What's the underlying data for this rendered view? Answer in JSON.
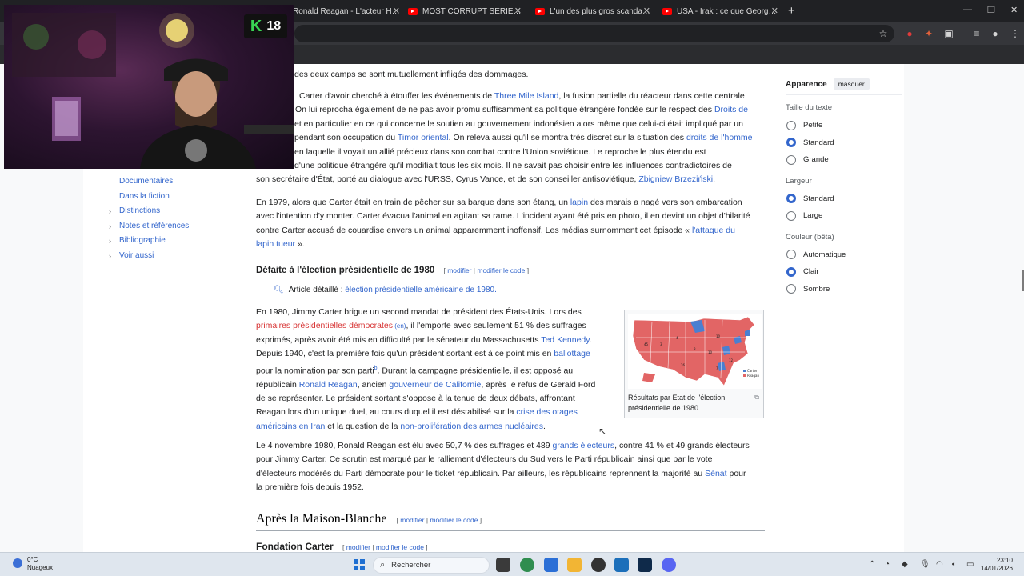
{
  "browser": {
    "tabs": [
      {
        "label": "Ronald Reagan - L'acteur Holly…"
      },
      {
        "label": "MOST CORRUPT SERIES: Presid…"
      },
      {
        "label": "L'un des plus gros scandale de…"
      },
      {
        "label": "USA - Irak : ce que George W B…"
      }
    ]
  },
  "webcam": {
    "badge_letter": "K",
    "badge_number": "18"
  },
  "toc": {
    "items": [
      {
        "label": "Documentaires",
        "expandable": false
      },
      {
        "label": "Dans la fiction",
        "expandable": false
      },
      {
        "label": "Distinctions",
        "expandable": true
      },
      {
        "label": "Notes et références",
        "expandable": true
      },
      {
        "label": "Bibliographie",
        "expandable": true
      },
      {
        "label": "Voir aussi",
        "expandable": true
      }
    ]
  },
  "article": {
    "p0": {
      "l1": "des deux camps se sont mutuellement infligés des dommages."
    },
    "p1": {
      "l1a": "Carter d'avoir cherché à étouffer les événements de ",
      "l1_link": "Three Mile Island",
      "l1b": ", la fusion partielle du réacteur dans cette centrale",
      "l2a": "On lui reprocha également de ne pas avoir promu suffisamment sa politique étrangère fondée sur le respect des ",
      "l2_link": "Droits de",
      "l3": "et en particulier en ce qui concerne le soutien au gouvernement indonésien alors même que celui-ci était impliqué par un",
      "l4a": "pendant son occupation du ",
      "l4_link": "Timor oriental",
      "l4b": ". On releva aussi qu'il se montra très discret sur la situation des ",
      "l4_link2": "droits de l'homme",
      "l5": "en laquelle il voyait un allié précieux dans son combat contre l'Union soviétique. Le reproche le plus étendu est",
      "l6": "d'une politique étrangère qu'il modifiait tous les six mois. Il ne savait pas choisir entre les influences contradictoires de",
      "l7a": "son secrétaire d'État, porté au dialogue avec l'URSS, Cyrus Vance, et de son conseiller antisoviétique, ",
      "l7_link": "Zbigniew Brzeziński",
      "l7b": "."
    },
    "p2": {
      "l1a": "En 1979, alors que Carter était en train de pêcher sur sa barque dans son étang, un ",
      "l1_link": "lapin",
      "l1b": " des marais a nagé vers son embarcation",
      "l2": "avec l'intention d'y monter. Carter évacua l'animal en agitant sa rame. L'incident ayant été pris en photo, il en devint un objet d'hilarité",
      "l3a": "contre Carter accusé de couardise envers un animal apparemment inoffensif. Les médias surnomment cet épisode « ",
      "l3_link": "l'attaque du",
      "l4_link": "lapin tueur",
      "l4b": " »."
    },
    "section_1980": {
      "title": "Défaite à l'élection présidentielle de 1980",
      "edit_open": "[ ",
      "edit": "modifier",
      "sep": " | ",
      "edit_code": "modifier le code",
      "edit_close": " ]",
      "hatnote_label": "Article détaillé : ",
      "hatnote_link": "élection présidentielle américaine de 1980."
    },
    "p3": {
      "l1": "En 1980, Jimmy Carter brigue un second mandat de président des États-Unis. Lors des",
      "l2_link": "primaires présidentielles démocrates",
      "l2_en": " (en)",
      "l2b": ", il l'emporte avec seulement 51 % des suffrages",
      "l3a": "exprimés, après avoir été mis en difficulté par le sénateur du Massachusetts ",
      "l3_link": "Ted Kennedy",
      "l3b": ".",
      "l4a": "Depuis 1940, c'est la première fois qu'un président sortant est à ce point mis en ",
      "l4_link": "ballottage",
      "l5a": "pour la nomination par son parti",
      "l5_sup": "b",
      "l5b": ". Durant la campagne présidentielle, il est opposé au",
      "l6a": "républicain ",
      "l6_link": "Ronald Reagan",
      "l6b": ", ancien ",
      "l6_link2": "gouverneur de Californie",
      "l6c": ", après le refus de Gerald Ford",
      "l7": "de se représenter. Le président sortant s'oppose à la tenue de deux débats, affrontant",
      "l8a": "Reagan lors d'un unique duel, au cours duquel il est déstabilisé sur la ",
      "l8_link": "crise des otages",
      "l9_link": "américains en Iran",
      "l9b": " et la question de la ",
      "l9_link2": "non-prolifération des armes nucléaires",
      "l9c": "."
    },
    "p4": {
      "l1a": "Le 4 novembre 1980, Ronald Reagan est élu avec 50,7 % des suffrages et 489 ",
      "l1_link": "grands électeurs",
      "l1b": ", contre 41 % et 49 grands électeurs",
      "l2": "pour Jimmy Carter. Ce scrutin est marqué par le ralliement d'électeurs du Sud vers le Parti républicain ainsi que par le vote",
      "l3a": "d'électeurs modérés du Parti démocrate pour le ticket républicain. Par ailleurs, les républicains reprennent la majorité au ",
      "l3_link": "Sénat",
      "l3b": " pour",
      "l4": "la première fois depuis 1952."
    },
    "figure": {
      "caption": "Résultats par État de l'élection présidentielle de 1980.",
      "legend_carter": "Carter",
      "legend_reagan": "Reagan"
    },
    "section_after": {
      "title": "Après la Maison-Blanche",
      "edit_open": "[ ",
      "edit": "modifier",
      "sep": " | ",
      "edit_code": "modifier le code",
      "edit_close": " ]"
    },
    "section_foundation": {
      "title": "Fondation Carter",
      "edit_open": "[ ",
      "edit": "modifier",
      "sep": " | ",
      "edit_code": "modifier le code",
      "edit_close": " ]"
    }
  },
  "appearance": {
    "title": "Apparence",
    "hide_button": "masquer",
    "text_size": {
      "heading": "Taille du texte",
      "options": [
        "Petite",
        "Standard",
        "Grande"
      ],
      "selected": 1
    },
    "width": {
      "heading": "Largeur",
      "options": [
        "Standard",
        "Large"
      ],
      "selected": 0
    },
    "color": {
      "heading": "Couleur (bêta)",
      "options": [
        "Automatique",
        "Clair",
        "Sombre"
      ],
      "selected": 1
    }
  },
  "taskbar": {
    "weather_temp": "0°C",
    "weather_desc": "Nuageux",
    "search_placeholder": "Rechercher",
    "time": "23:10",
    "date": "14/01/2026"
  },
  "colors": {
    "link": "#3366cc",
    "redlink": "#d73333",
    "democrat": "#4a7fd1",
    "republican": "#e26565"
  }
}
